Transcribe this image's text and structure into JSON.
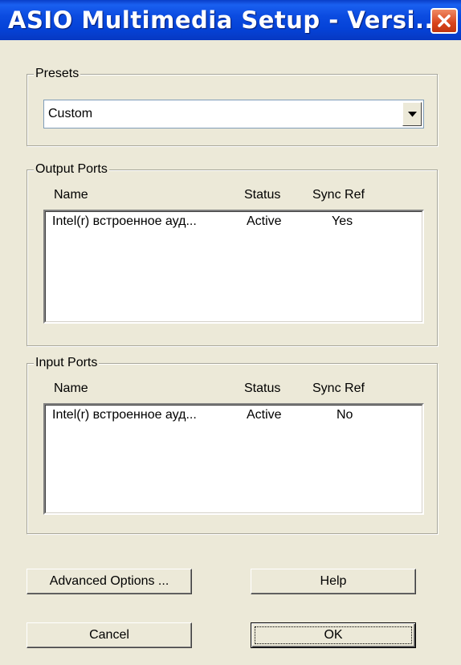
{
  "window": {
    "title": "ASIO Multimedia Setup  -  Versi..."
  },
  "presets": {
    "label": "Presets",
    "selected": "Custom"
  },
  "columns": {
    "name": "Name",
    "status": "Status",
    "sync_ref": "Sync Ref"
  },
  "output_ports": {
    "label": "Output Ports",
    "rows": [
      {
        "name": "Intel(r) встроенное ауд...",
        "status": "Active",
        "sync_ref": "Yes"
      }
    ]
  },
  "input_ports": {
    "label": "Input Ports",
    "rows": [
      {
        "name": "Intel(r) встроенное ауд...",
        "status": "Active",
        "sync_ref": "No"
      }
    ]
  },
  "buttons": {
    "advanced": "Advanced Options ...",
    "help": "Help",
    "cancel": "Cancel",
    "ok": "OK"
  },
  "icons": {
    "close": "close-icon",
    "dropdown": "chevron-down-icon"
  },
  "colors": {
    "titlebar": "#0543d8",
    "close_button": "#d8441c",
    "dialog_bg": "#ece9d8"
  }
}
